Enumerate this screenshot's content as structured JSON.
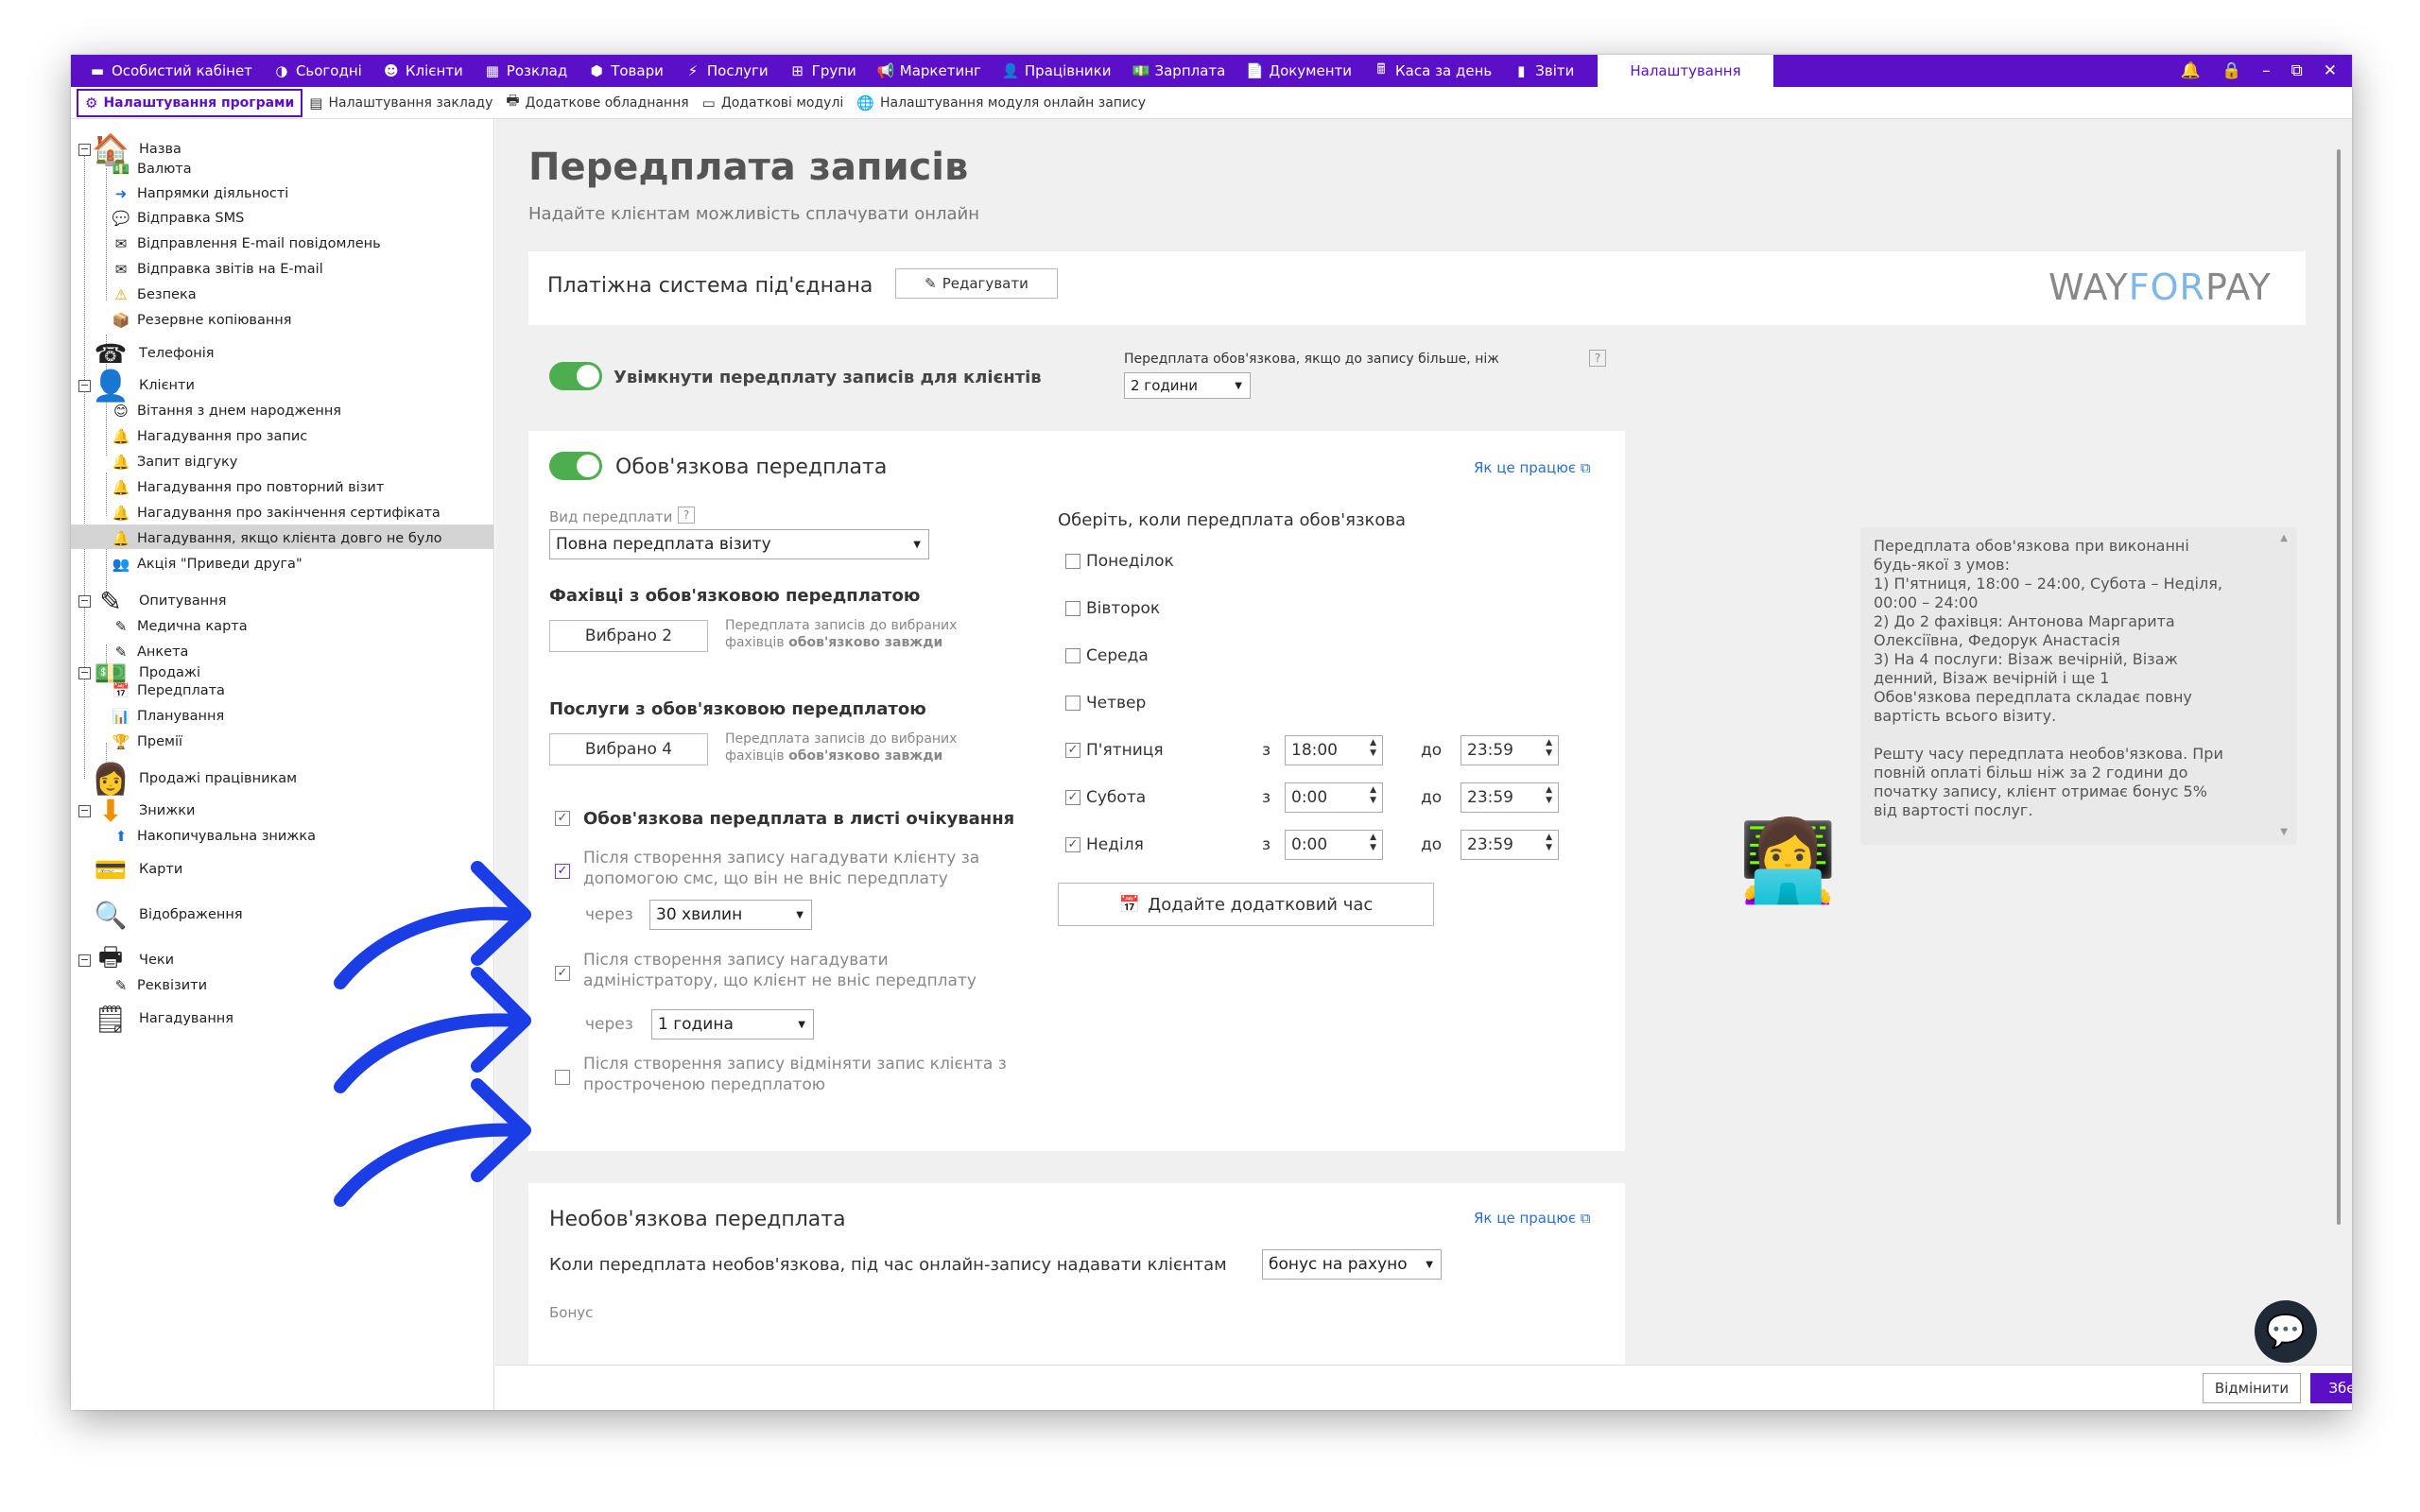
{
  "topnav": [
    {
      "label": "Особистий кабінет",
      "icon": "▬"
    },
    {
      "label": "Сьогодні",
      "icon": "◑"
    },
    {
      "label": "Клієнти",
      "icon": "☻"
    },
    {
      "label": "Розклад",
      "icon": "▦"
    },
    {
      "label": "Товари",
      "icon": "⬢"
    },
    {
      "label": "Послуги",
      "icon": "⚡"
    },
    {
      "label": "Групи",
      "icon": "⊞"
    },
    {
      "label": "Маркетинг",
      "icon": "📢"
    },
    {
      "label": "Працівники",
      "icon": "👤"
    },
    {
      "label": "Зарплата",
      "icon": "💵"
    },
    {
      "label": "Документи",
      "icon": "📄"
    },
    {
      "label": "Каса за день",
      "icon": "🖩"
    },
    {
      "label": "Звіти",
      "icon": "▮"
    }
  ],
  "topnav_active": "Налаштування",
  "subtabs": [
    {
      "label": "Налаштування програми",
      "icon": "⚙"
    },
    {
      "label": "Налаштування закладу",
      "icon": "▤"
    },
    {
      "label": "Додаткове обладнання",
      "icon": "🖶"
    },
    {
      "label": "Додаткові модулі",
      "icon": "▭"
    },
    {
      "label": "Налаштування модуля онлайн запису",
      "icon": "🌐"
    }
  ],
  "tree": {
    "nazva": "Назва",
    "valuta": "Валюта",
    "napriamky": "Напрямки діяльності",
    "sms": "Відправка SMS",
    "email": "Відправлення E-mail повідомлень",
    "zvity": "Відправка звітів на E-mail",
    "bezpeka": "Безпека",
    "backup": "Резервне копіювання",
    "telefonia": "Телефонія",
    "klienty": "Клієнти",
    "vitannia": "Вітання з днем народження",
    "nagad_zapys": "Нагадування про запис",
    "zapyt": "Запит відгуку",
    "povtor": "Нагадування про повторний візит",
    "sertyf": "Нагадування про закінчення сертифіката",
    "dovgo": "Нагадування, якщо клієнта довго не було",
    "akcia": "Акція \"Приведи друга\"",
    "opytuvannia": "Опитування",
    "medkarta": "Медична карта",
    "anketa": "Анкета",
    "prodazhi": "Продажі",
    "peredplata": "Передплата",
    "planuvannia": "Планування",
    "premii": "Премії",
    "prodazhi_prac": "Продажі працівникам",
    "znyzhky": "Знижки",
    "nakopych": "Накопичувальна знижка",
    "karty": "Карти",
    "vidobrazhennia": "Відображення",
    "cheky": "Чеки",
    "rekvizyty": "Реквізити",
    "nagaduvannia": "Нагадування"
  },
  "page": {
    "title": "Передплата записів",
    "subtitle": "Надайте клієнтам можливість сплачувати онлайн"
  },
  "payment": {
    "label": "Платіжна система під'єднана",
    "edit": "Редагувати",
    "logo_left": "WAY",
    "logo_mid": "FOR",
    "logo_right": "PAY"
  },
  "enable": {
    "label": "Увімкнути передплату записів для клієнтів",
    "threshold_label": "Передплата обов'язкова, якщо до запису більше, ніж",
    "threshold_value": "2 години",
    "help": "?"
  },
  "mandatory": {
    "title": "Обов'язкова передплата",
    "how": "Як це працює",
    "type_label": "Вид передплати",
    "type_value": "Повна передплата візиту",
    "specialists_title": "Фахівці з обов'язковою передплатою",
    "specialists_btn": "Вибрано 2",
    "specialists_note1": "Передплата записів до вибраних",
    "specialists_note2": "фахівців",
    "specialists_note3": "обов'язково завжди",
    "services_title": "Послуги з обов'язковою передплатою",
    "services_btn": "Вибрано 4",
    "services_note1": "Передплата записів до вибраних",
    "services_note2": "фахівців",
    "services_note3": "обов'язково завжди",
    "waitlist": "Обов'язкова передплата в листі очікування",
    "remind_client_1": "Після створення запису нагадувати клієнту за",
    "remind_client_2": "допомогою смс, що він не вніс передплату",
    "via": "через",
    "client_delay": "30 хвилин",
    "remind_admin_1": "Після створення запису нагадувати",
    "remind_admin_2": "адміністратору, що клієнт не вніс передплату",
    "admin_delay": "1 година",
    "cancel_1": "Після створення запису відміняти запис клієнта з",
    "cancel_2": "простроченою передплатою",
    "days_title": "Оберіть, коли передплата обов'язкова",
    "days": [
      {
        "label": "Понеділок",
        "checked": false
      },
      {
        "label": "Вівторок",
        "checked": false
      },
      {
        "label": "Середа",
        "checked": false
      },
      {
        "label": "Четвер",
        "checked": false
      },
      {
        "label": "П'ятниця",
        "checked": true,
        "from": "18:00",
        "to": "23:59"
      },
      {
        "label": "Субота",
        "checked": true,
        "from": "0:00",
        "to": "23:59"
      },
      {
        "label": "Неділя",
        "checked": true,
        "from": "0:00",
        "to": "23:59"
      }
    ],
    "from_label": "з",
    "to_label": "до",
    "add_time": "Додайте додатковий час"
  },
  "tooltip": {
    "lines": [
      "Передплата обов'язкова при виконанні",
      "будь-якої з умов:",
      "1) П'ятниця, 18:00 – 24:00, Субота – Неділя,",
      "00:00 – 24:00",
      "2) До 2 фахівця:  Антонова Маргарита",
      "Олексіївна, Федорук Анастасія",
      "3) На 4 послуги: Візаж вечірній, Візаж",
      "денний, Візаж вечірній і ще 1",
      "Обов'язкова передплата складає повну",
      "вартість всього візиту.",
      "",
      "Решту часу передплата необов'язкова. При",
      "повній оплаті більш ніж за 2 години до",
      "початку запису, клієнт отримає бонус 5%",
      "від вартості послуг."
    ]
  },
  "optional": {
    "title": "Необов'язкова передплата",
    "how": "Як це працює",
    "question": "Коли передплата необов'язкова, під час онлайн-запису надавати клієнтам",
    "value": "бонус на рахуно",
    "bonus": "Бонус"
  },
  "footer": {
    "cancel": "Відмінити",
    "save": "Зберегти"
  },
  "colors": {
    "accent": "#5b10c8",
    "switch": "#4cae4f",
    "arrow": "#1b3de6",
    "link": "#2a6fd6"
  }
}
